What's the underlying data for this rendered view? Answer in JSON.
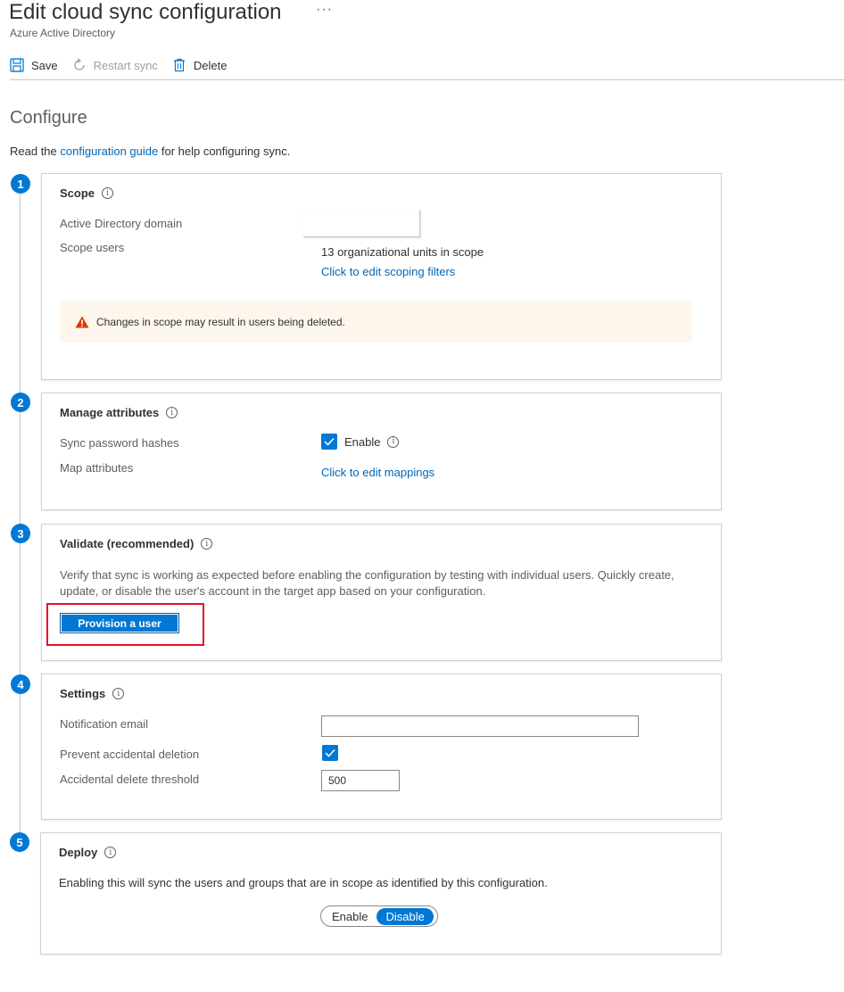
{
  "header": {
    "title": "Edit cloud sync configuration",
    "ellipsis": "···",
    "subtitle": "Azure Active Directory"
  },
  "toolbar": {
    "save_label": "Save",
    "restart_label": "Restart sync",
    "delete_label": "Delete"
  },
  "configure": {
    "heading": "Configure",
    "intro_before": "Read the ",
    "intro_link": "configuration guide",
    "intro_after": " for help configuring sync."
  },
  "steps": {
    "scope": {
      "number": "1",
      "title": "Scope",
      "ad_domain_label": "Active Directory domain",
      "scope_users_label": "Scope users",
      "scope_users_value": "13 organizational units in scope",
      "edit_filters_link": "Click to edit scoping filters",
      "warning": "Changes in scope may result in users being deleted."
    },
    "attributes": {
      "number": "2",
      "title": "Manage attributes",
      "sync_password_label": "Sync password hashes",
      "enable_label": "Enable",
      "map_attributes_label": "Map attributes",
      "edit_mappings_link": "Click to edit mappings"
    },
    "validate": {
      "number": "3",
      "title": "Validate (recommended)",
      "description_line1": "Verify that sync is working as expected before enabling the configuration by testing with individual users. Quickly create,",
      "description_line2": "update, or disable the user's account in the target app based on your configuration.",
      "provision_button": "Provision a user"
    },
    "settings": {
      "number": "4",
      "title": "Settings",
      "notification_email_label": "Notification email",
      "notification_email_value": "",
      "prevent_deletion_label": "Prevent accidental deletion",
      "threshold_label": "Accidental delete threshold",
      "threshold_value": "500"
    },
    "deploy": {
      "number": "5",
      "title": "Deploy",
      "description": "Enabling this will sync the users and groups that are in scope as identified by this configuration.",
      "enable_option": "Enable",
      "disable_option": "Disable",
      "selected": "Disable"
    }
  },
  "colors": {
    "accent": "#0078d4",
    "link": "#0067b8",
    "warning_icon": "#d83b01",
    "highlight_border": "#e81123"
  },
  "icons": {
    "save": "save-icon",
    "restart": "restart-icon",
    "delete": "delete-icon",
    "info": "info-icon",
    "warning": "warning-icon",
    "check": "checkmark-icon"
  }
}
